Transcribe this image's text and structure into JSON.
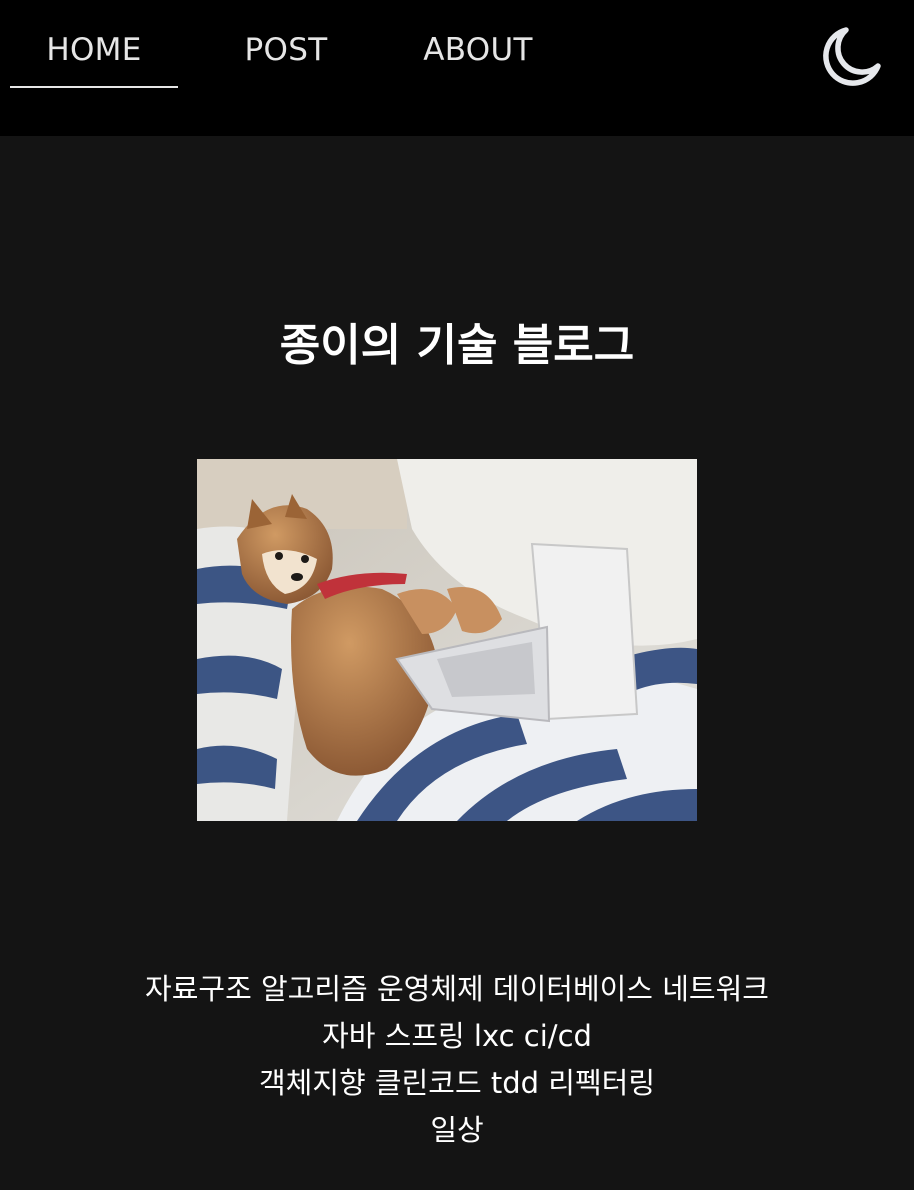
{
  "nav": {
    "home": "HOME",
    "post": "POST",
    "about": "ABOUT",
    "active": "HOME"
  },
  "theme_toggle": {
    "icon": "moon-icon"
  },
  "hero": {
    "title": "종이의 기술 블로그",
    "image": "shiba-inu-dog-with-laptop-on-bed"
  },
  "tags": [
    [
      "자료구조",
      "알고리즘",
      "운영체제",
      "데이터베이스",
      "네트워크"
    ],
    [
      "자바",
      "스프링",
      "lxc",
      "ci/cd"
    ],
    [
      "객체지향",
      "클린코드",
      "tdd",
      "리펙터링"
    ],
    [
      "일상"
    ]
  ],
  "colors": {
    "topbar": "#000000",
    "background": "#141414",
    "text": "#ffffff",
    "nav_text": "#e6e6e6"
  }
}
